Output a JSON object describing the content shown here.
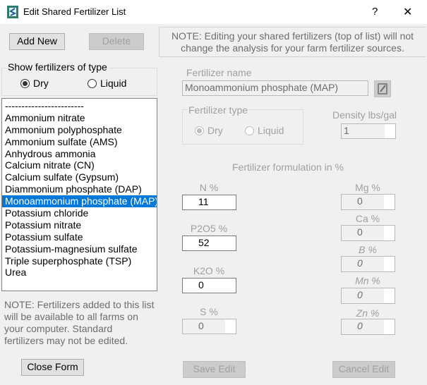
{
  "window": {
    "title": "Edit Shared Fertilizer List",
    "help": "?",
    "close": "✕"
  },
  "toolbar": {
    "add_new": "Add New",
    "delete": "Delete"
  },
  "note_top": "NOTE: Editing your shared fertilizers (top of list) will not change the analysis for your farm fertilizer sources.",
  "type_filter": {
    "title": "Show fertilizers of type",
    "dry": "Dry",
    "liquid": "Liquid",
    "selected": "Dry"
  },
  "list": {
    "items": [
      "------------------------",
      "Ammonium nitrate",
      "Ammonium polyphosphate",
      "Ammonium sulfate (AMS)",
      "Anhydrous ammonia",
      "Calcium nitrate (CN)",
      "Calcium sulfate (Gypsum)",
      "Diammonium phosphate (DAP)",
      "Monoammonium phosphate (MAP)",
      "Potassium chloride",
      "Potassium nitrate",
      "Potassium sulfate",
      "Potassium-magnesium sulfate",
      "Triple superphosphate (TSP)",
      "Urea"
    ],
    "selected": "Monoammonium phosphate (MAP)"
  },
  "note_bottom": "NOTE: Fertilizers added to this list will be available to all farms on your computer.  Standard fertilizers may not be edited.",
  "close_form": "Close Form",
  "detail": {
    "name_label": "Fertilizer name",
    "name_value": "Monoammonium phosphate (MAP)",
    "type_label": "Fertilizer type",
    "type_dry": "Dry",
    "type_liquid": "Liquid",
    "density_label": "Density lbs/gal",
    "density_value": "1",
    "formulation_label": "Fertilizer formulation in %",
    "n_label": "N %",
    "n_value": "11",
    "p_label": "P2O5 %",
    "p_value": "52",
    "k_label": "K2O %",
    "k_value": "0",
    "s_label": "S %",
    "s_value": "0",
    "mg_label": "Mg %",
    "mg_value": "0",
    "ca_label": "Ca %",
    "ca_value": "0",
    "b_label": "B %",
    "b_value": "0",
    "mn_label": "Mn %",
    "mn_value": "0",
    "zn_label": "Zn %",
    "zn_value": "0",
    "save": "Save Edit",
    "cancel": "Cancel Edit"
  },
  "colors": {
    "selection": "#0078d7",
    "background": "#f0f0f0"
  }
}
